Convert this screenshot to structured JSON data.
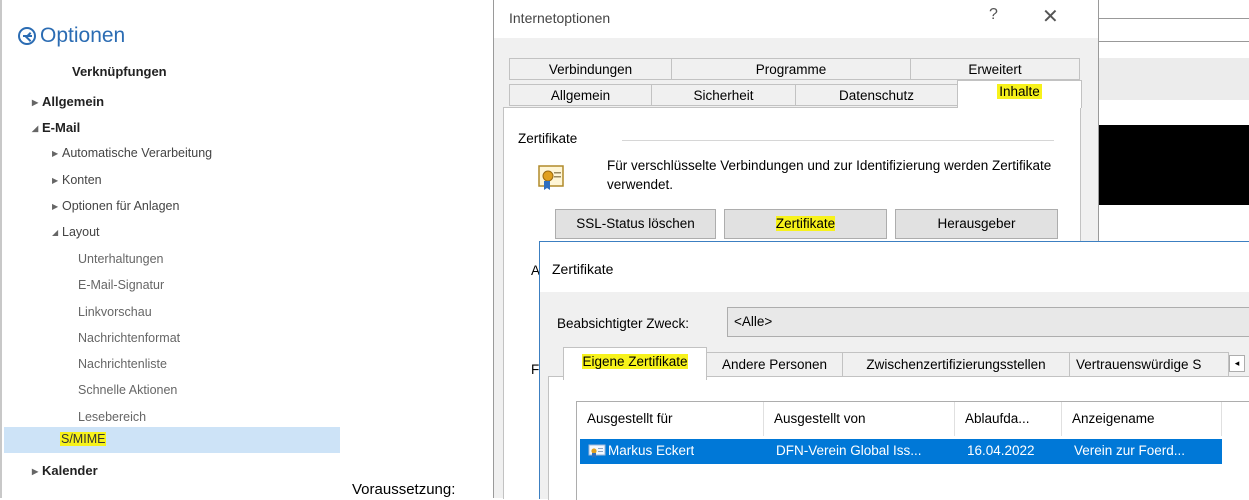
{
  "outlook_options": {
    "title": "Optionen",
    "items": [
      {
        "label": "Verknüpfungen"
      },
      {
        "label": "Allgemein"
      },
      {
        "label": "E-Mail"
      },
      {
        "label": "Automatische Verarbeitung"
      },
      {
        "label": "Konten"
      },
      {
        "label": "Optionen für Anlagen"
      },
      {
        "label": "Layout"
      },
      {
        "label": "Unterhaltungen"
      },
      {
        "label": "E-Mail-Signatur"
      },
      {
        "label": "Linkvorschau"
      },
      {
        "label": "Nachrichtenformat"
      },
      {
        "label": "Nachrichtenliste"
      },
      {
        "label": "Schnelle Aktionen"
      },
      {
        "label": "Lesebereich"
      },
      {
        "label": "S/MIME"
      },
      {
        "label": "Kalender"
      }
    ]
  },
  "caption": "Voraussetzung:",
  "internet_options": {
    "title": "Internetoptionen",
    "help": "?",
    "close": "✕",
    "tabs_top": [
      "Verbindungen",
      "Programme",
      "Erweitert"
    ],
    "tabs_bottom": [
      "Allgemein",
      "Sicherheit",
      "Datenschutz",
      "Inhalte"
    ],
    "group_label": "Zertifikate",
    "description": "Für verschlüsselte Verbindungen und zur Identifizierung werden Zertifikate verwendet.",
    "buttons": [
      "SSL-Status löschen",
      "Zertifikate",
      "Herausgeber"
    ],
    "fragment_au": "Au",
    "fragment_fe": "Fe"
  },
  "certificates_dialog": {
    "title": "Zertifikate",
    "purpose_label": "Beabsichtigter Zweck:",
    "purpose_value": "<Alle>",
    "tabs": [
      "Eigene Zertifikate",
      "Andere Personen",
      "Zwischenzertifizierungsstellen",
      "Vertrauenswürdige S"
    ],
    "scroll_arrow": "◂",
    "columns": [
      "Ausgestellt für",
      "Ausgestellt von",
      "Ablaufda...",
      "Anzeigename"
    ],
    "rows": [
      {
        "issued_to": "Markus Eckert",
        "issued_by": "DFN-Verein Global Iss...",
        "expires": "16.04.2022",
        "display_name": "Verein zur Foerd..."
      }
    ]
  },
  "colors": {
    "highlight": "#f7f21b",
    "selection": "#0078d7",
    "nav_selected": "#cde3f7",
    "accent": "#2b6cb3"
  }
}
